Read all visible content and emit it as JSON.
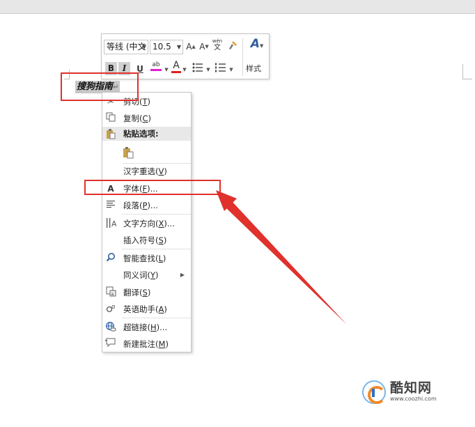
{
  "toolbar": {
    "font_name": "等线 (中文",
    "font_size": "10.5",
    "grow_font": "A",
    "shrink_font": "A",
    "phonetic_top": "wén",
    "phonetic_char": "文",
    "bold": "B",
    "italic": "I",
    "underline": "U",
    "highlight": "ab",
    "font_color": "A",
    "styles_icon": "A",
    "styles_label": "样式"
  },
  "document": {
    "selected_text": "搜狗指南",
    "paragraph_mark": "↵"
  },
  "context_menu": {
    "items": [
      {
        "icon": "scissors-icon",
        "label": "剪切(",
        "key": "T",
        "suffix": ")"
      },
      {
        "icon": "copy-icon",
        "label": "复制(",
        "key": "C",
        "suffix": ")"
      },
      {
        "icon": "paste-icon",
        "label": "粘贴选项:",
        "key": "",
        "suffix": ""
      },
      {
        "icon": "keep-text-paste-icon",
        "label": "",
        "key": "",
        "suffix": ""
      },
      {
        "icon": "",
        "label": "汉字重选(",
        "key": "V",
        "suffix": ")"
      },
      {
        "icon": "font-icon",
        "label": "字体(",
        "key": "F",
        "suffix": ")..."
      },
      {
        "icon": "paragraph-icon",
        "label": "段落(",
        "key": "P",
        "suffix": ")..."
      },
      {
        "icon": "text-direction-icon",
        "label": "文字方向(",
        "key": "X",
        "suffix": ")..."
      },
      {
        "icon": "",
        "label": "插入符号(",
        "key": "S",
        "suffix": ")"
      },
      {
        "icon": "smart-lookup-icon",
        "label": "智能查找(",
        "key": "L",
        "suffix": ")"
      },
      {
        "icon": "",
        "label": "同义词(",
        "key": "Y",
        "suffix": ")"
      },
      {
        "icon": "translate-icon",
        "label": "翻译(",
        "key": "S",
        "suffix": ")"
      },
      {
        "icon": "english-assistant-icon",
        "label": "英语助手(",
        "key": "A",
        "suffix": ")"
      },
      {
        "icon": "hyperlink-icon",
        "label": "超链接(",
        "key": "H",
        "suffix": ")..."
      },
      {
        "icon": "new-comment-icon",
        "label": "新建批注(",
        "key": "M",
        "suffix": ")"
      }
    ]
  },
  "watermark": {
    "name": "酷知网",
    "url": "www.coozhi.com"
  },
  "colors": {
    "annotation_red": "#e0312c",
    "highlight_magenta": "#e020d0",
    "font_color_red": "#e02020",
    "selection_gray": "#c8c8c8"
  }
}
